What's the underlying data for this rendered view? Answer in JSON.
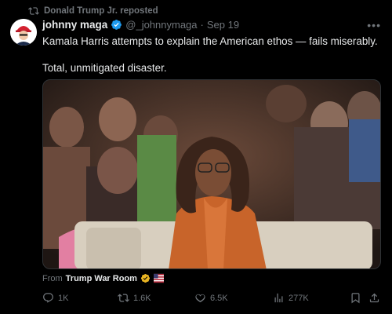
{
  "repost": {
    "label": "Donald Trump Jr. reposted"
  },
  "author": {
    "name": "johnny maga",
    "handle": "@_johnnymaga",
    "separator": "·",
    "date": "Sep 19"
  },
  "tweet": {
    "line1": "Kamala Harris attempts to explain the American ethos — fails miserably.",
    "line2": "Total, unmitigated disaster."
  },
  "source": {
    "prefix": "From",
    "name": "Trump War Room"
  },
  "actions": {
    "replies": "1K",
    "reposts": "1.6K",
    "likes": "6.5K",
    "views": "277K"
  },
  "colors": {
    "background": "#000000",
    "text": "#e7e9ea",
    "muted": "#71767b",
    "verified": "#1d9bf0",
    "accent_orange": "#c8642a"
  },
  "icons": [
    "repost-icon",
    "verified-badge-icon",
    "more-icon",
    "flag-icon",
    "reply-icon",
    "repost-icon",
    "like-icon",
    "views-icon",
    "bookmark-icon",
    "share-icon"
  ]
}
